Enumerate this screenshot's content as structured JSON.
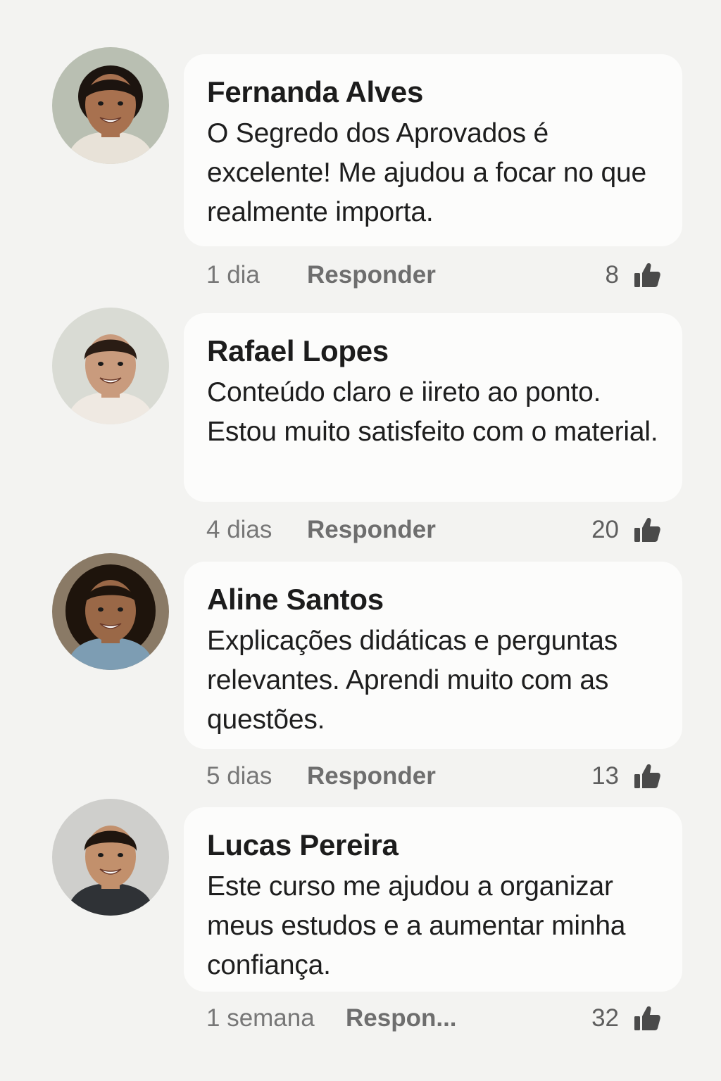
{
  "comments": [
    {
      "author": "Fernanda Alves",
      "text": "O Segredo dos Aprovados é excelente! Me ajudou a focar no que realmente importa.",
      "time": "1 dia",
      "reply_label": "Responder",
      "likes": "8",
      "avatar": {
        "bg": "#b9bfb2",
        "skin": "#a8714f",
        "hair": "#1c140f",
        "shirt": "#e8e2d8",
        "hair_style": "bun"
      }
    },
    {
      "author": "Rafael Lopes",
      "text": "Conteúdo claro e iireto ao ponto. Estou muito satisfeito com o material.",
      "time": "4 dias",
      "reply_label": "Responder",
      "likes": "20",
      "avatar": {
        "bg": "#d9dbd4",
        "skin": "#c99b7d",
        "hair": "#2a1c14",
        "shirt": "#efe9e2",
        "hair_style": "short"
      }
    },
    {
      "author": "Aline Santos",
      "text": "Explicações didáticas e perguntas relevantes. Aprendi muito com as questões.",
      "time": "5 dias",
      "reply_label": "Responder",
      "likes": "13",
      "avatar": {
        "bg": "#8a7a66",
        "skin": "#9a6847",
        "hair": "#1e140c",
        "shirt": "#7d9db3",
        "hair_style": "curly"
      }
    },
    {
      "author": "Lucas Pereira",
      "text": "Este curso me ajudou a organizar meus estudos e a aumentar minha confiança.",
      "time": "1 semana",
      "reply_label": "Respon...",
      "likes": "32",
      "avatar": {
        "bg": "#cfcfcc",
        "skin": "#c2906c",
        "hair": "#1f150e",
        "shirt": "#2f3236",
        "hair_style": "short"
      }
    }
  ],
  "icons": {
    "like": "thumbs-up-icon"
  }
}
